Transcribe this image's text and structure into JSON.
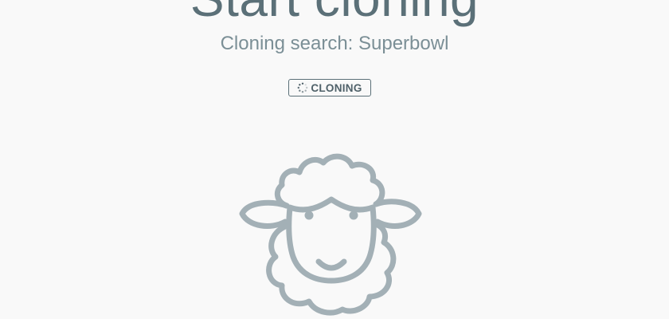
{
  "header": {
    "title": "Start cloning",
    "subtitle": "Cloning search: Superbowl"
  },
  "status": {
    "label": "CLONING",
    "icon": "spinner-icon"
  },
  "illustration": {
    "icon": "sheep-icon"
  },
  "colors": {
    "background": "#f9f9f9",
    "text": "#5b7078",
    "illustration": "#a3b0b6"
  }
}
